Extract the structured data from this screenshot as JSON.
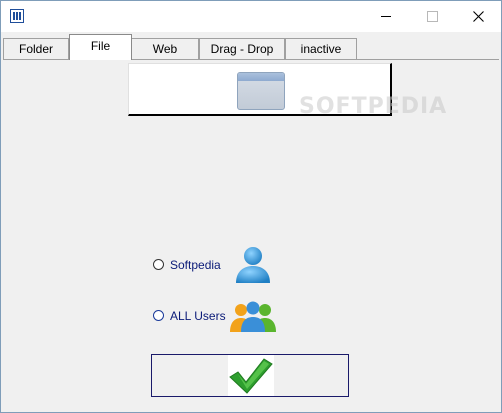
{
  "window": {
    "controls": {
      "minimize_icon": "minimize-icon",
      "maximize_icon": "maximize-icon",
      "close_icon": "close-icon"
    }
  },
  "tabs": [
    {
      "label": "Folder",
      "active": false
    },
    {
      "label": "File",
      "active": true
    },
    {
      "label": "Web",
      "active": false
    },
    {
      "label": "Drag - Drop",
      "active": false
    },
    {
      "label": "inactive",
      "active": false
    }
  ],
  "file_panel": {
    "browse_icon": "window-icon",
    "watermark": "SOFTPEDIA"
  },
  "user_options": [
    {
      "label": "Softpedia",
      "icon": "user-icon"
    },
    {
      "label": "ALL Users",
      "icon": "users-icon"
    }
  ],
  "confirm": {
    "icon": "checkmark-icon"
  },
  "colors": {
    "radio_label": "#0a1a78",
    "checkmark": "#2e9e2e",
    "user": "#2a8fd0"
  }
}
